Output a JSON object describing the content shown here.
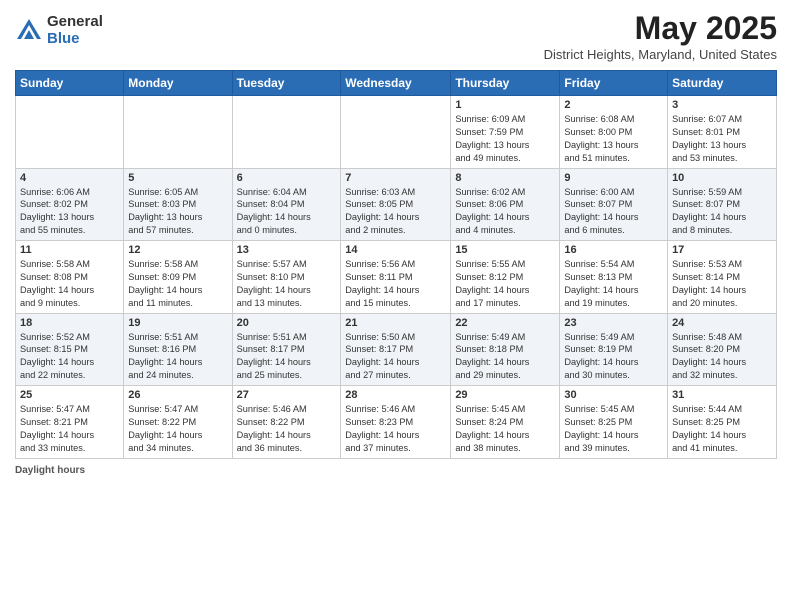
{
  "header": {
    "logo_general": "General",
    "logo_blue": "Blue",
    "month_title": "May 2025",
    "location": "District Heights, Maryland, United States"
  },
  "days_of_week": [
    "Sunday",
    "Monday",
    "Tuesday",
    "Wednesday",
    "Thursday",
    "Friday",
    "Saturday"
  ],
  "weeks": [
    [
      {
        "day": "",
        "info": ""
      },
      {
        "day": "",
        "info": ""
      },
      {
        "day": "",
        "info": ""
      },
      {
        "day": "",
        "info": ""
      },
      {
        "day": "1",
        "info": "Sunrise: 6:09 AM\nSunset: 7:59 PM\nDaylight: 13 hours\nand 49 minutes."
      },
      {
        "day": "2",
        "info": "Sunrise: 6:08 AM\nSunset: 8:00 PM\nDaylight: 13 hours\nand 51 minutes."
      },
      {
        "day": "3",
        "info": "Sunrise: 6:07 AM\nSunset: 8:01 PM\nDaylight: 13 hours\nand 53 minutes."
      }
    ],
    [
      {
        "day": "4",
        "info": "Sunrise: 6:06 AM\nSunset: 8:02 PM\nDaylight: 13 hours\nand 55 minutes."
      },
      {
        "day": "5",
        "info": "Sunrise: 6:05 AM\nSunset: 8:03 PM\nDaylight: 13 hours\nand 57 minutes."
      },
      {
        "day": "6",
        "info": "Sunrise: 6:04 AM\nSunset: 8:04 PM\nDaylight: 14 hours\nand 0 minutes."
      },
      {
        "day": "7",
        "info": "Sunrise: 6:03 AM\nSunset: 8:05 PM\nDaylight: 14 hours\nand 2 minutes."
      },
      {
        "day": "8",
        "info": "Sunrise: 6:02 AM\nSunset: 8:06 PM\nDaylight: 14 hours\nand 4 minutes."
      },
      {
        "day": "9",
        "info": "Sunrise: 6:00 AM\nSunset: 8:07 PM\nDaylight: 14 hours\nand 6 minutes."
      },
      {
        "day": "10",
        "info": "Sunrise: 5:59 AM\nSunset: 8:07 PM\nDaylight: 14 hours\nand 8 minutes."
      }
    ],
    [
      {
        "day": "11",
        "info": "Sunrise: 5:58 AM\nSunset: 8:08 PM\nDaylight: 14 hours\nand 9 minutes."
      },
      {
        "day": "12",
        "info": "Sunrise: 5:58 AM\nSunset: 8:09 PM\nDaylight: 14 hours\nand 11 minutes."
      },
      {
        "day": "13",
        "info": "Sunrise: 5:57 AM\nSunset: 8:10 PM\nDaylight: 14 hours\nand 13 minutes."
      },
      {
        "day": "14",
        "info": "Sunrise: 5:56 AM\nSunset: 8:11 PM\nDaylight: 14 hours\nand 15 minutes."
      },
      {
        "day": "15",
        "info": "Sunrise: 5:55 AM\nSunset: 8:12 PM\nDaylight: 14 hours\nand 17 minutes."
      },
      {
        "day": "16",
        "info": "Sunrise: 5:54 AM\nSunset: 8:13 PM\nDaylight: 14 hours\nand 19 minutes."
      },
      {
        "day": "17",
        "info": "Sunrise: 5:53 AM\nSunset: 8:14 PM\nDaylight: 14 hours\nand 20 minutes."
      }
    ],
    [
      {
        "day": "18",
        "info": "Sunrise: 5:52 AM\nSunset: 8:15 PM\nDaylight: 14 hours\nand 22 minutes."
      },
      {
        "day": "19",
        "info": "Sunrise: 5:51 AM\nSunset: 8:16 PM\nDaylight: 14 hours\nand 24 minutes."
      },
      {
        "day": "20",
        "info": "Sunrise: 5:51 AM\nSunset: 8:17 PM\nDaylight: 14 hours\nand 25 minutes."
      },
      {
        "day": "21",
        "info": "Sunrise: 5:50 AM\nSunset: 8:17 PM\nDaylight: 14 hours\nand 27 minutes."
      },
      {
        "day": "22",
        "info": "Sunrise: 5:49 AM\nSunset: 8:18 PM\nDaylight: 14 hours\nand 29 minutes."
      },
      {
        "day": "23",
        "info": "Sunrise: 5:49 AM\nSunset: 8:19 PM\nDaylight: 14 hours\nand 30 minutes."
      },
      {
        "day": "24",
        "info": "Sunrise: 5:48 AM\nSunset: 8:20 PM\nDaylight: 14 hours\nand 32 minutes."
      }
    ],
    [
      {
        "day": "25",
        "info": "Sunrise: 5:47 AM\nSunset: 8:21 PM\nDaylight: 14 hours\nand 33 minutes."
      },
      {
        "day": "26",
        "info": "Sunrise: 5:47 AM\nSunset: 8:22 PM\nDaylight: 14 hours\nand 34 minutes."
      },
      {
        "day": "27",
        "info": "Sunrise: 5:46 AM\nSunset: 8:22 PM\nDaylight: 14 hours\nand 36 minutes."
      },
      {
        "day": "28",
        "info": "Sunrise: 5:46 AM\nSunset: 8:23 PM\nDaylight: 14 hours\nand 37 minutes."
      },
      {
        "day": "29",
        "info": "Sunrise: 5:45 AM\nSunset: 8:24 PM\nDaylight: 14 hours\nand 38 minutes."
      },
      {
        "day": "30",
        "info": "Sunrise: 5:45 AM\nSunset: 8:25 PM\nDaylight: 14 hours\nand 39 minutes."
      },
      {
        "day": "31",
        "info": "Sunrise: 5:44 AM\nSunset: 8:25 PM\nDaylight: 14 hours\nand 41 minutes."
      }
    ]
  ],
  "footer": {
    "label": "Daylight hours"
  }
}
